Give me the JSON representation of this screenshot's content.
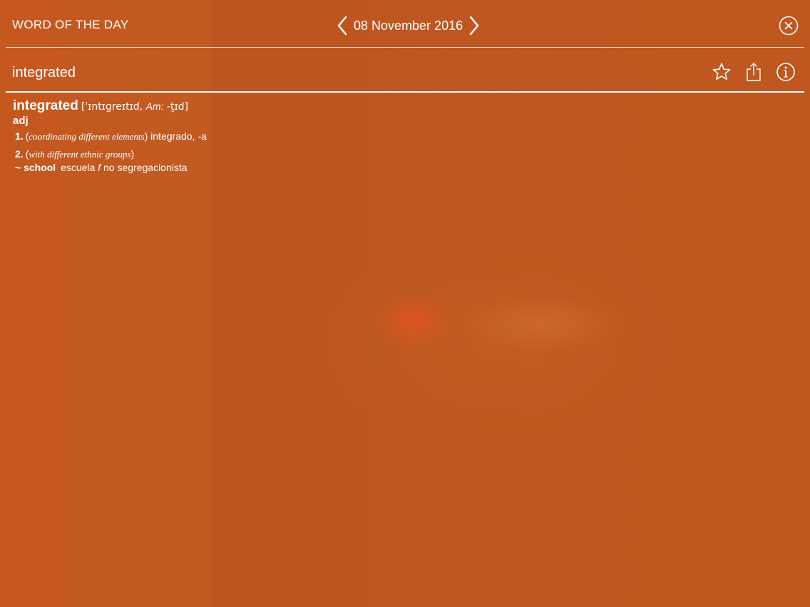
{
  "header": {
    "title": "WORD OF THE DAY",
    "date": "08 November 2016"
  },
  "icons": {
    "prev": "chevron-left-icon",
    "next": "chevron-right-icon",
    "close": "close-circle-icon",
    "favorite": "star-outline-icon",
    "share": "share-icon",
    "info": "info-circle-icon"
  },
  "search_bar": {
    "word": "integrated"
  },
  "entry": {
    "headword": "integrated",
    "pron_open": "[ˈɪntɪɡreɪtɪd, ",
    "pron_am_label": "Am:",
    "pron_am": " -t̬ɪd]",
    "pos": "adj",
    "senses": [
      {
        "num": "1.",
        "gloss_open": "(",
        "gloss": "coordinating different elements",
        "gloss_close": ")",
        "translation": " integrado, -a"
      },
      {
        "num": "2.",
        "gloss_open": "(",
        "gloss": "with different ethnic groups",
        "gloss_close": ")",
        "translation": ""
      }
    ],
    "example": {
      "phrase": "~ school",
      "text_before": " escuela ",
      "gender": "f",
      "text_after": " no segregacionista"
    }
  },
  "colors": {
    "background": "#c0571f",
    "foreground": "#ffffff"
  }
}
